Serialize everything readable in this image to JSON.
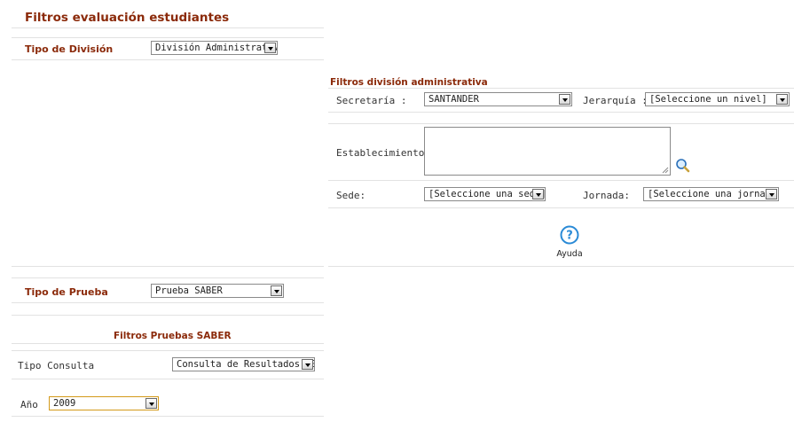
{
  "left": {
    "title": "Filtros evaluación estudiantes",
    "tipo_division": {
      "label": "Tipo de División",
      "value": "División Administrativa"
    },
    "tipo_prueba": {
      "label": "Tipo de Prueba",
      "value": "Prueba SABER"
    },
    "saber": {
      "title": "Filtros Pruebas SABER",
      "tipo_consulta": {
        "label": "Tipo Consulta",
        "value": "Consulta de Resultados SE"
      },
      "anio": {
        "label": "Año",
        "value": "2009"
      }
    }
  },
  "right": {
    "title": "Filtros división administrativa",
    "secretaria": {
      "label": "Secretaría :",
      "value": "SANTANDER"
    },
    "jerarquia": {
      "label": "Jerarquía :",
      "value": "[Seleccione un nivel]"
    },
    "establecimiento": {
      "label": "Establecimiento :",
      "value": ""
    },
    "sede": {
      "label": "Sede:",
      "value": "[Seleccione una sede]"
    },
    "jornada": {
      "label": "Jornada:",
      "value": "[Seleccione una jornada]"
    },
    "ayuda": {
      "label": "Ayuda",
      "icon": "help-circle-icon"
    }
  },
  "colors": {
    "title": "#8b2a0a",
    "accent_blue": "#2a8ad6",
    "highlight": "#d49a1a"
  }
}
